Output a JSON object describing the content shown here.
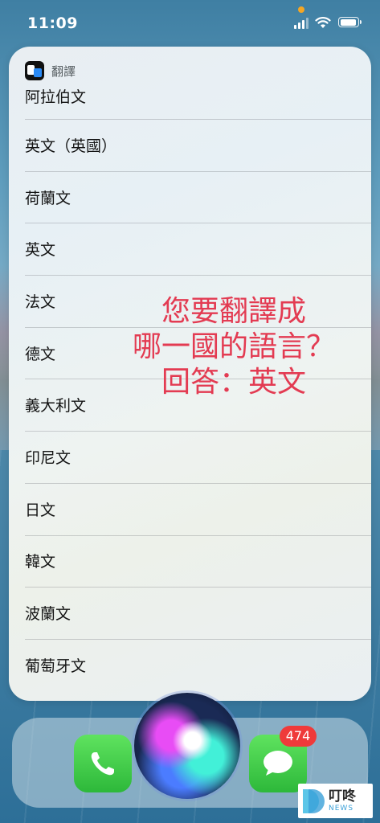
{
  "status_bar": {
    "time": "11:09"
  },
  "siri_card": {
    "app_name": "翻譯",
    "languages": [
      "阿拉伯文",
      "英文（英國）",
      "荷蘭文",
      "英文",
      "法文",
      "德文",
      "義大利文",
      "印尼文",
      "日文",
      "韓文",
      "波蘭文",
      "葡萄牙文"
    ]
  },
  "overlay_caption": {
    "line1": "您要翻譯成",
    "line2": "哪一國的語言？",
    "line3": "回答：英文",
    "color": "#e33b52"
  },
  "dock": {
    "apps": [
      {
        "name": "phone-icon"
      },
      {
        "name": "messages-icon",
        "badge": "474"
      }
    ]
  },
  "watermark": {
    "cn": "叮咚",
    "en": "NEWS"
  }
}
